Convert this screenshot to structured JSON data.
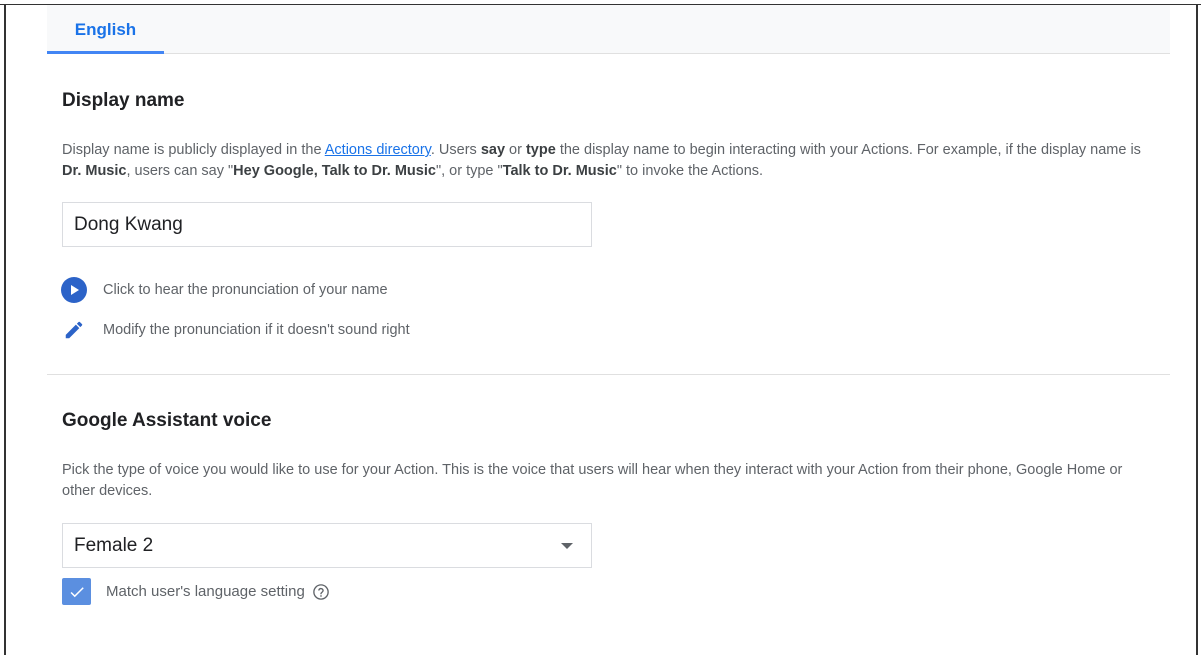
{
  "tabs": [
    {
      "label": "English",
      "active": true
    }
  ],
  "display_name": {
    "heading": "Display name",
    "desc_1": "Display name is publicly displayed in the ",
    "link": "Actions directory",
    "desc_2": ". Users ",
    "say": "say",
    "desc_3": " or ",
    "type": "type",
    "desc_4": " the display name to begin interacting with your Actions. For example, if the display name is ",
    "dr_music": "Dr. Music",
    "desc_5": ", users can say \"",
    "hey_google": "Hey Google, Talk to Dr. Music",
    "desc_6": "\", or type \"",
    "talk_to": "Talk to Dr. Music",
    "desc_7": "\" to invoke the Actions.",
    "input_value": "Dong Kwang",
    "hear_label": "Click to hear the pronunciation of your name",
    "modify_label": "Modify the pronunciation if it doesn't sound right"
  },
  "voice": {
    "heading": "Google Assistant voice",
    "description": "Pick the type of voice you would like to use for your Action. This is the voice that users will hear when they interact with your Action from their phone, Google Home or other devices.",
    "selected": "Female 2",
    "match_label": "Match user's language setting",
    "match_checked": true
  },
  "colors": {
    "accent": "#1a73e8",
    "play_button": "#2c63c8",
    "checkbox": "#5b8fe0"
  },
  "icons": [
    "play-icon",
    "pencil-icon",
    "dropdown-caret-icon",
    "checkmark-icon",
    "help-icon"
  ]
}
